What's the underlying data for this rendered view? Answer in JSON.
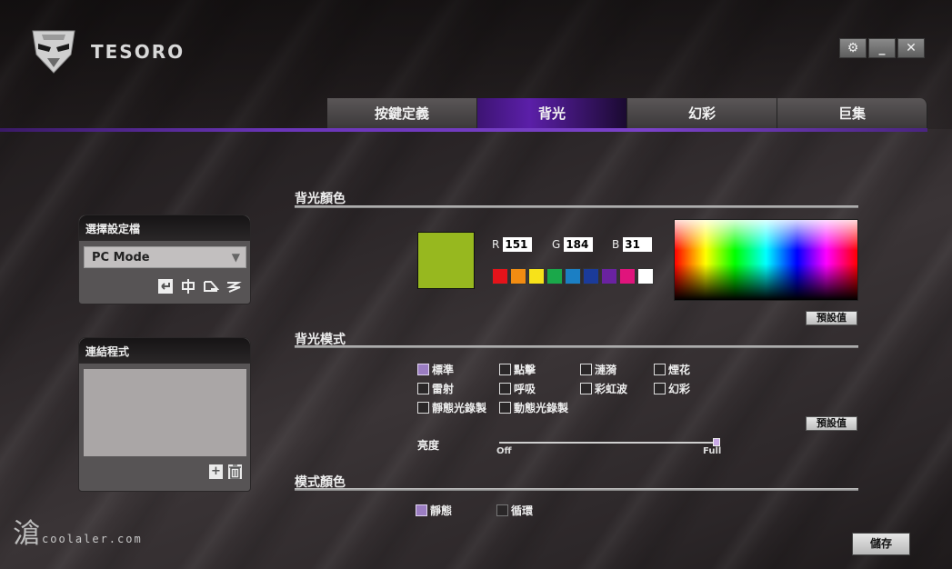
{
  "app": {
    "logo_text": "TESORO"
  },
  "window_controls": {
    "settings": "⚙",
    "minimize": "_",
    "close": "✕"
  },
  "tabs": [
    {
      "label": "按鍵定義",
      "active": false
    },
    {
      "label": "背光",
      "active": true
    },
    {
      "label": "幻彩",
      "active": false
    },
    {
      "label": "巨集",
      "active": false
    }
  ],
  "profile_panel": {
    "title": "選擇設定檔",
    "selected": "PC Mode",
    "arrow": "▼"
  },
  "link_panel": {
    "title": "連結程式"
  },
  "backlight_color": {
    "title": "背光顏色",
    "current_color": "#97B81F",
    "r_label": "R",
    "r_value": "151",
    "g_label": "G",
    "g_value": "184",
    "b_label": "B",
    "b_value": "31",
    "palette": [
      "#e4131a",
      "#f28c12",
      "#f7e21a",
      "#1aa84a",
      "#1b7fc4",
      "#1b3b9a",
      "#6a22a0",
      "#e0147c",
      "#ffffff"
    ],
    "default_button": "預設值"
  },
  "backlight_mode": {
    "title": "背光模式",
    "options": [
      {
        "label": "標準",
        "checked": true
      },
      {
        "label": "點擊",
        "checked": false
      },
      {
        "label": "漣漪",
        "checked": false
      },
      {
        "label": "煙花",
        "checked": false
      },
      {
        "label": "雷射",
        "checked": false
      },
      {
        "label": "呼吸",
        "checked": false
      },
      {
        "label": "彩虹波",
        "checked": false
      },
      {
        "label": "幻彩",
        "checked": false
      },
      {
        "label": "靜態光錄製",
        "checked": false
      },
      {
        "label": "動態光錄製",
        "checked": false
      }
    ],
    "default_button": "預設值",
    "brightness_label": "亮度",
    "brightness_min": "Off",
    "brightness_max": "Full",
    "brightness_value": 1.0
  },
  "mode_color": {
    "title": "模式顏色",
    "options": [
      {
        "label": "靜態",
        "checked": true
      },
      {
        "label": "循環",
        "checked": false
      }
    ]
  },
  "save_button": "儲存",
  "watermark": {
    "glyph": "滄",
    "text": "coolaler.com"
  }
}
